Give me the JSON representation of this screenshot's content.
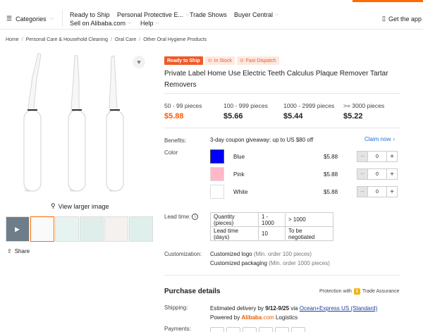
{
  "header": {
    "categories_label": "Categories",
    "links": [
      "Ready to Ship",
      "Personal Protective E...",
      "Trade Shows",
      "Buyer Central",
      "Sell on Alibaba.com",
      "Help"
    ],
    "get_app_label": "Get the app",
    "accent_color": "#ff6a00"
  },
  "breadcrumb": [
    "Home",
    "Personal Care & Household Cleaning",
    "Oral Care",
    "Other Oral Hygiene Products"
  ],
  "gallery": {
    "view_larger_label": "View larger image",
    "share_label": "Share"
  },
  "product": {
    "badges": {
      "ready_to_ship": "Ready to Ship",
      "in_stock": "In Stock",
      "fast_dispatch": "Fast Dispatch"
    },
    "title": "Private Label Home Use Electric Teeth Calculus Plaque Remover Tartar Removers",
    "tiers": [
      {
        "qty": "50 - 99 pieces",
        "price": "$5.88"
      },
      {
        "qty": "100 - 999 pieces",
        "price": "$5.66"
      },
      {
        "qty": "1000 - 2999 pieces",
        "price": "$5.44"
      },
      {
        "qty": ">= 3000 pieces",
        "price": "$5.22"
      }
    ],
    "benefits_label": "Benefits:",
    "benefit_text": "3-day coupon giveaway: up to US $80 off",
    "claim_label": "Claim now",
    "color_label": "Color",
    "colors": [
      {
        "name": "Blue",
        "price": "$5.88",
        "qty": "0",
        "swatch": "#0000ff"
      },
      {
        "name": "Pink",
        "price": "$5.88",
        "qty": "0",
        "swatch": "#ffb8c6"
      },
      {
        "name": "White",
        "price": "$5.88",
        "qty": "0",
        "swatch": "#ffffff"
      }
    ],
    "lead_time_label": "Lead time:",
    "lead_table": {
      "row1": [
        "Quantity (pieces)",
        "1 - 1000",
        "> 1000"
      ],
      "row2": [
        "Lead time (days)",
        "10",
        "To be negotiated"
      ]
    },
    "customization_label": "Customization:",
    "customizations": [
      {
        "name": "Customized logo",
        "note": "(Min. order 100 pieces)"
      },
      {
        "name": "Customized packaging",
        "note": "(Min. order 1000 pieces)"
      }
    ]
  },
  "purchase": {
    "title": "Purchase details",
    "protection_prefix": "Protection with",
    "protection_name": "Trade Assurance",
    "shipping_label": "Shipping:",
    "shipping_prefix": "Estimated delivery by",
    "shipping_dates": "9/12-9/25",
    "shipping_via": "via",
    "shipping_link": "Ocean+Express US (Standard)",
    "powered_prefix": "Powered by",
    "powered_brand": "Alibaba",
    "powered_brand_suffix": ".com",
    "powered_suffix": "Logistics",
    "payments_label": "Payments:"
  }
}
